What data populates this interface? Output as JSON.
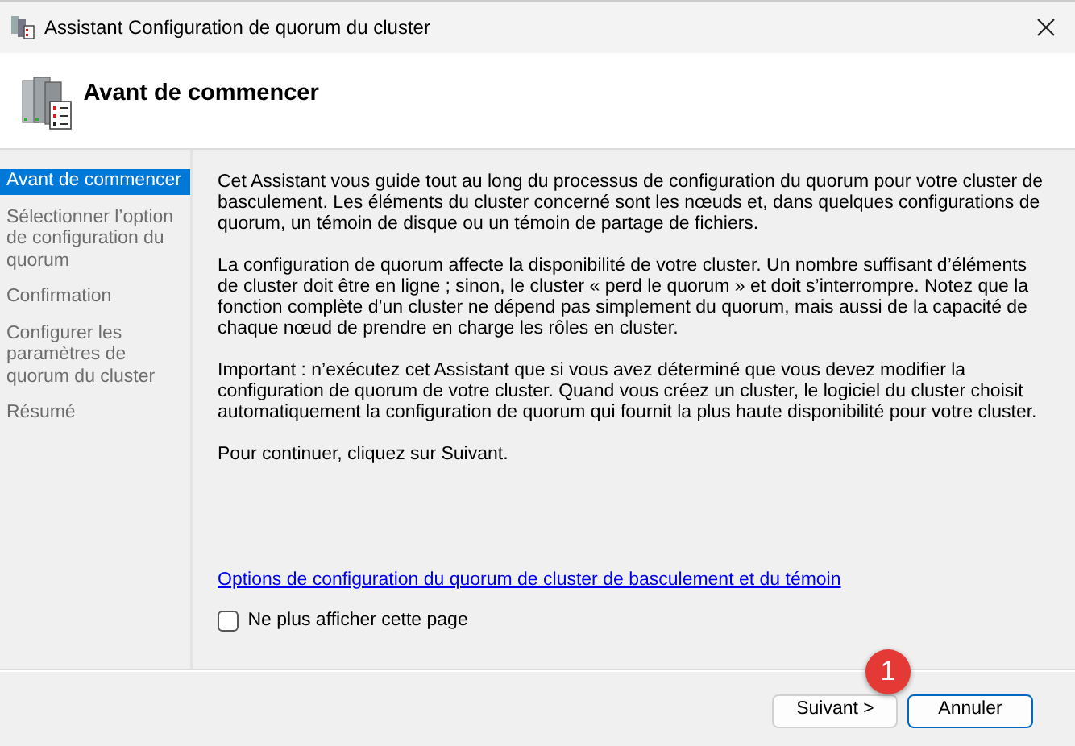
{
  "window": {
    "title": "Assistant Configuration de quorum du cluster"
  },
  "header": {
    "title": "Avant de commencer"
  },
  "steps": [
    {
      "label": "Avant de commencer",
      "selected": true
    },
    {
      "label": "Sélectionner l’option de configuration du quorum",
      "selected": false
    },
    {
      "label": "Confirmation",
      "selected": false
    },
    {
      "label": "Configurer les paramètres de quorum du cluster",
      "selected": false
    },
    {
      "label": "Résumé",
      "selected": false
    }
  ],
  "paragraphs": [
    "Cet Assistant vous guide tout au long du processus de configuration du quorum pour votre cluster de basculement. Les éléments du cluster concerné sont les nœuds et, dans quelques configurations de quorum, un témoin de disque ou un témoin de partage de fichiers.",
    "La configuration de quorum affecte la disponibilité de votre cluster. Un nombre suffisant d’éléments de cluster doit être en ligne ; sinon, le cluster « perd le quorum » et doit s’interrompre. Notez que la fonction complète d’un cluster ne dépend pas simplement du quorum, mais aussi de la capacité de chaque nœud de prendre en charge les rôles en cluster.",
    "Important : n’exécutez cet Assistant que si vous avez déterminé que vous devez modifier la configuration de quorum de votre cluster. Quand vous créez un cluster, le logiciel du cluster choisit automatiquement la configuration de quorum qui fournit la plus haute disponibilité pour votre cluster.",
    "Pour continuer, cliquez sur Suivant."
  ],
  "link": "Options de configuration du quorum de cluster de basculement et du témoin",
  "checkbox": {
    "label": "Ne plus afficher cette page",
    "checked": false
  },
  "buttons": [
    {
      "label": "Suivant >",
      "focused": false
    },
    {
      "label": "Annuler",
      "focused": true
    }
  ],
  "callout": {
    "number": "1"
  }
}
